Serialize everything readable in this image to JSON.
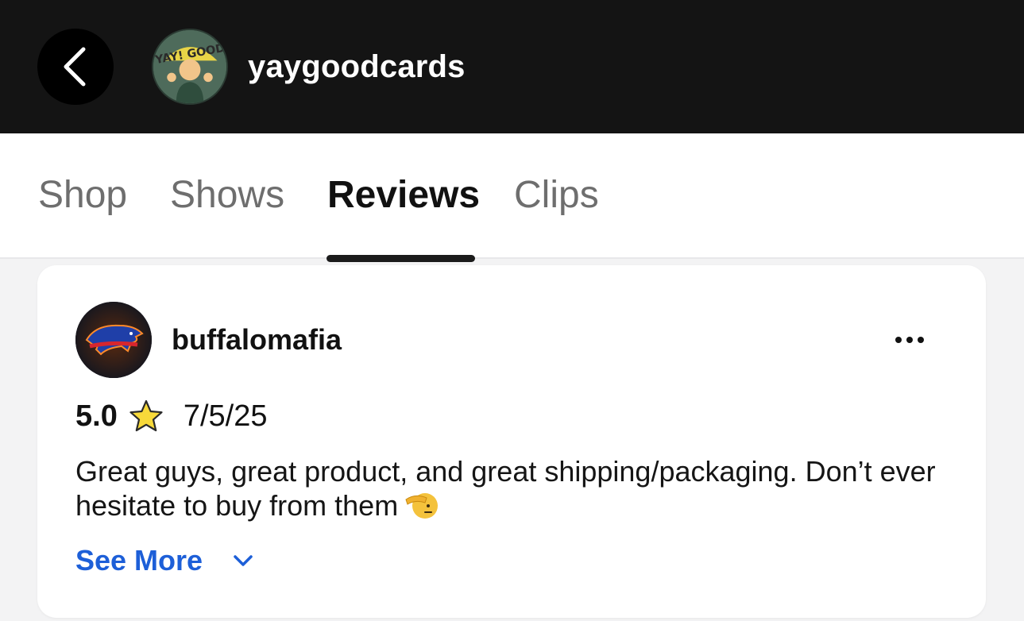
{
  "header": {
    "shop_name": "yaygoodcards",
    "avatar_text": "YAY! GOOD"
  },
  "tabs": [
    {
      "label": "Shop",
      "active": false
    },
    {
      "label": "Shows",
      "active": false
    },
    {
      "label": "Reviews",
      "active": true
    },
    {
      "label": "Clips",
      "active": false
    }
  ],
  "review": {
    "reviewer": "buffalomafia",
    "rating": "5.0",
    "date": "7/5/25",
    "text": "Great guys, great product, and great shipping/packaging. Don’t ever hesitate to buy from them",
    "see_more": "See More"
  },
  "colors": {
    "header_bg": "#141414",
    "link": "#1d5fd8",
    "star": "#f7d93a"
  },
  "icons": [
    "back-arrow-icon",
    "more-options-icon",
    "star-icon",
    "salute-icon",
    "chevron-down-icon"
  ]
}
